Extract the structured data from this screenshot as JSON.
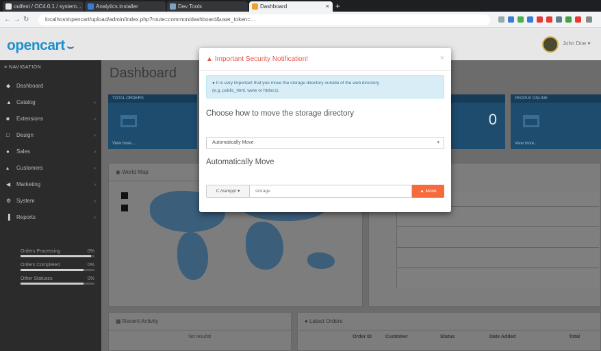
{
  "browser": {
    "tabs": [
      {
        "label": "oulfest / OC4.0.1 / system...",
        "favicon_color": "#e8e8e8",
        "active": false
      },
      {
        "label": "Analytics installer",
        "favicon_color": "#3b7bd6",
        "active": false
      },
      {
        "label": "Dev Tools",
        "favicon_color": "#7aa0c4",
        "active": false
      },
      {
        "label": "Dashboard",
        "favicon_color": "#f0a030",
        "active": true
      }
    ],
    "new_tab_glyph": "+",
    "url": "localhost/opencart/upload/admin/index.php?route=common/dashboard&user_token=..."
  },
  "header": {
    "logo_text": "opencart",
    "logo_cart_glyph": "⌣",
    "user_name": "John Doe ▾"
  },
  "sidebar": {
    "nav_title": "≡ NAVIGATION",
    "items": [
      {
        "icon": "◆",
        "label": "Dashboard",
        "has_children": false
      },
      {
        "icon": "▲",
        "label": "Catalog",
        "has_children": true
      },
      {
        "icon": "■",
        "label": "Extensions",
        "has_children": true
      },
      {
        "icon": "□",
        "label": "Design",
        "has_children": true
      },
      {
        "icon": "●",
        "label": "Sales",
        "has_children": true
      },
      {
        "icon": "▴",
        "label": "Customers",
        "has_children": true
      },
      {
        "icon": "◀",
        "label": "Marketing",
        "has_children": true
      },
      {
        "icon": "⚙",
        "label": "System",
        "has_children": true
      },
      {
        "icon": "▐",
        "label": "Reports",
        "has_children": true
      }
    ],
    "progress": [
      {
        "label": "Orders Processing",
        "value": "0%",
        "fraction": 0.95
      },
      {
        "label": "Orders Completed",
        "value": "0%",
        "fraction": 0.85
      },
      {
        "label": "Other Statuses",
        "value": "0%",
        "fraction": 0.85
      }
    ]
  },
  "main": {
    "title": "Dashboard",
    "tiles": [
      {
        "head": "TOTAL ORDERS",
        "foot": "View more...",
        "number": ""
      },
      {
        "head": "",
        "foot": "",
        "number": "0"
      },
      {
        "head": "PEOPLE ONLINE",
        "foot": "View more...",
        "number": ""
      }
    ],
    "world_map_title": "World Map",
    "recent_activity_title": "Recent Activity",
    "no_results": "No results!",
    "latest_orders_title": "Latest Orders",
    "orders_columns": [
      "Order ID",
      "Customer",
      "Status",
      "Date Added",
      "Total"
    ]
  },
  "modal": {
    "title": "Important Security Notification!",
    "warn_icon": "▲",
    "close_glyph": "×",
    "alert_line1": "It is very important that you move the storage directory outside of the web directory",
    "alert_line2": "(e.g. public_html, www or htdocs).",
    "choose_label": "Choose how to move the storage directory",
    "select_value": "Automatically Move",
    "auto_move_title": "Automatically Move",
    "addon_text": "C:/xampp/ ▾",
    "dir_input_value": "storage",
    "move_button": "▲ Move",
    "accent": "#f56b3e"
  }
}
